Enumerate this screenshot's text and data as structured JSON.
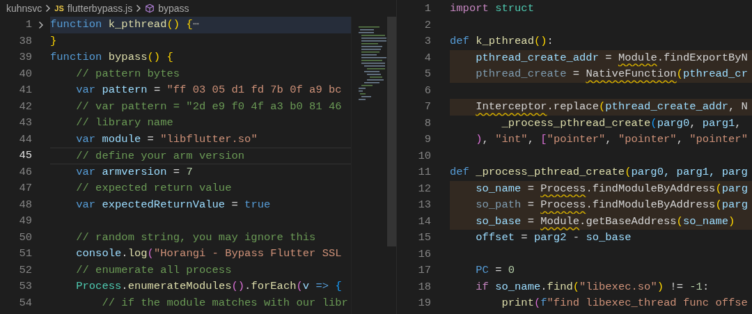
{
  "left_editor": {
    "breadcrumb": {
      "folder": "kuhnsvc",
      "file_icon": "JS",
      "file": "flutterbypass.js",
      "symbol": "bypass"
    },
    "lines": [
      {
        "number": "1",
        "folded": true,
        "current": false,
        "highlighted": true,
        "tokens": [
          {
            "text": "function",
            "kind": "keyword"
          },
          {
            "text": " k_pthread",
            "kind": "func"
          },
          {
            "text": "()",
            "kind": "gold"
          },
          {
            "text": " {",
            "kind": "gold"
          },
          {
            "text": "⋯",
            "kind": "fold"
          }
        ]
      },
      {
        "number": "38",
        "folded": false,
        "current": false,
        "highlighted": false,
        "tokens": [
          {
            "text": "}",
            "kind": "gold"
          }
        ]
      },
      {
        "number": "39",
        "folded": false,
        "current": false,
        "highlighted": false,
        "tokens": [
          {
            "text": "function",
            "kind": "keyword"
          },
          {
            "text": " bypass",
            "kind": "func"
          },
          {
            "text": "()",
            "kind": "gold"
          },
          {
            "text": " {",
            "kind": "gold"
          }
        ]
      },
      {
        "number": "40",
        "folded": false,
        "current": false,
        "highlighted": false,
        "tokens": [
          {
            "text": "    // pattern bytes",
            "kind": "comment"
          }
        ]
      },
      {
        "number": "41",
        "folded": false,
        "current": false,
        "highlighted": false,
        "tokens": [
          {
            "text": "    var",
            "kind": "keyword"
          },
          {
            "text": " pattern",
            "kind": "var"
          },
          {
            "text": " = ",
            "kind": "plain"
          },
          {
            "text": "\"ff 03 05 d1 fd 7b 0f a9 bc",
            "kind": "string"
          }
        ]
      },
      {
        "number": "42",
        "folded": false,
        "current": false,
        "highlighted": false,
        "tokens": [
          {
            "text": "    // var pattern = \"2d e9 f0 4f a3 b0 81 46",
            "kind": "comment"
          }
        ]
      },
      {
        "number": "43",
        "folded": false,
        "current": false,
        "highlighted": false,
        "tokens": [
          {
            "text": "    // library name",
            "kind": "comment"
          }
        ]
      },
      {
        "number": "44",
        "folded": false,
        "current": false,
        "highlighted": false,
        "tokens": [
          {
            "text": "    var",
            "kind": "keyword"
          },
          {
            "text": " module",
            "kind": "var"
          },
          {
            "text": " = ",
            "kind": "plain"
          },
          {
            "text": "\"libflutter.so\"",
            "kind": "string"
          }
        ]
      },
      {
        "number": "45",
        "folded": false,
        "current": true,
        "highlighted": false,
        "tokens": [
          {
            "text": "    // define your arm version",
            "kind": "comment"
          }
        ]
      },
      {
        "number": "46",
        "folded": false,
        "current": false,
        "highlighted": false,
        "tokens": [
          {
            "text": "    var",
            "kind": "keyword"
          },
          {
            "text": " armversion",
            "kind": "var"
          },
          {
            "text": " = ",
            "kind": "plain"
          },
          {
            "text": "7",
            "kind": "number"
          }
        ]
      },
      {
        "number": "47",
        "folded": false,
        "current": false,
        "highlighted": false,
        "tokens": [
          {
            "text": "    // expected return value",
            "kind": "comment"
          }
        ]
      },
      {
        "number": "48",
        "folded": false,
        "current": false,
        "highlighted": false,
        "tokens": [
          {
            "text": "    var",
            "kind": "keyword"
          },
          {
            "text": " expectedReturnValue",
            "kind": "var"
          },
          {
            "text": " = ",
            "kind": "plain"
          },
          {
            "text": "true",
            "kind": "keyword"
          }
        ]
      },
      {
        "number": "49",
        "folded": false,
        "current": false,
        "highlighted": false
      },
      {
        "number": "50",
        "folded": false,
        "current": false,
        "highlighted": false,
        "tokens": [
          {
            "text": "    // random string, you may ignore this",
            "kind": "comment"
          }
        ]
      },
      {
        "number": "51",
        "folded": false,
        "current": false,
        "highlighted": false,
        "tokens": [
          {
            "text": "    console",
            "kind": "var"
          },
          {
            "text": ".",
            "kind": "plain"
          },
          {
            "text": "log",
            "kind": "func"
          },
          {
            "text": "(",
            "kind": "purple"
          },
          {
            "text": "\"Horangi - Bypass Flutter SSL",
            "kind": "string"
          }
        ]
      },
      {
        "number": "52",
        "folded": false,
        "current": false,
        "highlighted": false,
        "tokens": [
          {
            "text": "    // enumerate all process",
            "kind": "comment"
          }
        ]
      },
      {
        "number": "53",
        "folded": false,
        "current": false,
        "highlighted": false,
        "tokens": [
          {
            "text": "    Process",
            "kind": "class"
          },
          {
            "text": ".",
            "kind": "plain"
          },
          {
            "text": "enumerateModules",
            "kind": "func"
          },
          {
            "text": "()",
            "kind": "purple"
          },
          {
            "text": ".",
            "kind": "plain"
          },
          {
            "text": "forEach",
            "kind": "func"
          },
          {
            "text": "(",
            "kind": "purple"
          },
          {
            "text": "v",
            "kind": "var"
          },
          {
            "text": " => ",
            "kind": "keyword"
          },
          {
            "text": "{",
            "kind": "blue"
          }
        ]
      },
      {
        "number": "54",
        "folded": false,
        "current": false,
        "highlighted": false,
        "tokens": [
          {
            "text": "        // if the module matches with our libr",
            "kind": "comment"
          }
        ]
      }
    ]
  },
  "right_editor": {
    "lines": [
      {
        "number": "1",
        "highlighted": false,
        "tokens": [
          {
            "text": "import",
            "kind": "control"
          },
          {
            "text": " struct",
            "kind": "class"
          }
        ]
      },
      {
        "number": "2",
        "highlighted": false
      },
      {
        "number": "3",
        "highlighted": false,
        "tokens": [
          {
            "text": "def",
            "kind": "keyword"
          },
          {
            "text": " k_pthread",
            "kind": "func"
          },
          {
            "text": "()",
            "kind": "gold"
          },
          {
            "text": ":",
            "kind": "plain"
          }
        ]
      },
      {
        "number": "4",
        "highlighted": true,
        "tokens": [
          {
            "text": "    pthread_create_addr",
            "kind": "var"
          },
          {
            "text": " = ",
            "kind": "plain"
          },
          {
            "text": "Module",
            "kind": "plain",
            "squiggly": true
          },
          {
            "text": ".findExportByN",
            "kind": "plain"
          }
        ]
      },
      {
        "number": "5",
        "highlighted": true,
        "tokens": [
          {
            "text": "    pthread_create",
            "kind": "dimvar"
          },
          {
            "text": " = ",
            "kind": "plain"
          },
          {
            "text": "NativeFunction",
            "kind": "plain",
            "squiggly": true
          },
          {
            "text": "(",
            "kind": "gold"
          },
          {
            "text": "pthread_cr",
            "kind": "var"
          }
        ]
      },
      {
        "number": "6",
        "highlighted": false
      },
      {
        "number": "7",
        "highlighted": true,
        "tokens": [
          {
            "text": "    Interceptor",
            "kind": "plain",
            "squiggly": true
          },
          {
            "text": ".replace",
            "kind": "plain"
          },
          {
            "text": "(",
            "kind": "gold"
          },
          {
            "text": "pthread_create_addr",
            "kind": "var"
          },
          {
            "text": ", N",
            "kind": "plain"
          }
        ]
      },
      {
        "number": "8",
        "highlighted": false,
        "tokens": [
          {
            "text": "        _process_pthread_create",
            "kind": "func"
          },
          {
            "text": "(",
            "kind": "blue"
          },
          {
            "text": "parg0",
            "kind": "var"
          },
          {
            "text": ", ",
            "kind": "plain"
          },
          {
            "text": "parg1",
            "kind": "var"
          },
          {
            "text": ",",
            "kind": "plain"
          }
        ]
      },
      {
        "number": "9",
        "highlighted": false,
        "tokens": [
          {
            "text": "    )",
            "kind": "purple"
          },
          {
            "text": ", ",
            "kind": "plain"
          },
          {
            "text": "\"int\"",
            "kind": "string"
          },
          {
            "text": ", ",
            "kind": "plain"
          },
          {
            "text": "[",
            "kind": "purple"
          },
          {
            "text": "\"pointer\"",
            "kind": "string"
          },
          {
            "text": ", ",
            "kind": "plain"
          },
          {
            "text": "\"pointer\"",
            "kind": "string"
          },
          {
            "text": ", ",
            "kind": "plain"
          },
          {
            "text": "\"pointer\"",
            "kind": "string"
          }
        ]
      },
      {
        "number": "10",
        "highlighted": false
      },
      {
        "number": "11",
        "highlighted": false,
        "tokens": [
          {
            "text": "def",
            "kind": "keyword"
          },
          {
            "text": " _process_pthread_create",
            "kind": "func"
          },
          {
            "text": "(",
            "kind": "gold"
          },
          {
            "text": "parg0, parg1, parg",
            "kind": "var"
          }
        ]
      },
      {
        "number": "12",
        "highlighted": true,
        "tokens": [
          {
            "text": "    so_name",
            "kind": "var"
          },
          {
            "text": " = ",
            "kind": "plain"
          },
          {
            "text": "Process",
            "kind": "plain",
            "squiggly": true
          },
          {
            "text": ".findModuleByAddress",
            "kind": "plain"
          },
          {
            "text": "(",
            "kind": "gold"
          },
          {
            "text": "parg",
            "kind": "var"
          }
        ]
      },
      {
        "number": "13",
        "highlighted": true,
        "tokens": [
          {
            "text": "    so_path",
            "kind": "dimvar"
          },
          {
            "text": " = ",
            "kind": "plain"
          },
          {
            "text": "Process",
            "kind": "plain",
            "squiggly": true
          },
          {
            "text": ".findModuleByAddress",
            "kind": "plain"
          },
          {
            "text": "(",
            "kind": "gold"
          },
          {
            "text": "parg",
            "kind": "var"
          }
        ]
      },
      {
        "number": "14",
        "highlighted": true,
        "tokens": [
          {
            "text": "    so_base",
            "kind": "var"
          },
          {
            "text": " = ",
            "kind": "plain"
          },
          {
            "text": "Module",
            "kind": "plain",
            "squiggly": true
          },
          {
            "text": ".getBaseAddress",
            "kind": "plain"
          },
          {
            "text": "(",
            "kind": "gold"
          },
          {
            "text": "so_name",
            "kind": "var"
          },
          {
            "text": ")",
            "kind": "gold"
          }
        ]
      },
      {
        "number": "15",
        "highlighted": false,
        "tokens": [
          {
            "text": "    offset",
            "kind": "var"
          },
          {
            "text": " = ",
            "kind": "plain"
          },
          {
            "text": "parg2",
            "kind": "var"
          },
          {
            "text": " - ",
            "kind": "plain"
          },
          {
            "text": "so_base",
            "kind": "var"
          }
        ]
      },
      {
        "number": "16",
        "highlighted": false
      },
      {
        "number": "17",
        "highlighted": false,
        "tokens": [
          {
            "text": "    PC",
            "kind": "keyword"
          },
          {
            "text": " = ",
            "kind": "plain"
          },
          {
            "text": "0",
            "kind": "number"
          }
        ]
      },
      {
        "number": "18",
        "highlighted": false,
        "tokens": [
          {
            "text": "    if",
            "kind": "control"
          },
          {
            "text": " so_name",
            "kind": "var"
          },
          {
            "text": ".",
            "kind": "plain"
          },
          {
            "text": "find",
            "kind": "func"
          },
          {
            "text": "(",
            "kind": "gold"
          },
          {
            "text": "\"libexec.so\"",
            "kind": "string"
          },
          {
            "text": ")",
            "kind": "gold"
          },
          {
            "text": " != ",
            "kind": "plain"
          },
          {
            "text": "-1",
            "kind": "number"
          },
          {
            "text": ":",
            "kind": "plain"
          }
        ]
      },
      {
        "number": "19",
        "highlighted": false,
        "tokens": [
          {
            "text": "        print",
            "kind": "func"
          },
          {
            "text": "(",
            "kind": "purple"
          },
          {
            "text": "f",
            "kind": "keyword"
          },
          {
            "text": "\"find libexec_thread func offse",
            "kind": "string"
          }
        ]
      }
    ]
  }
}
